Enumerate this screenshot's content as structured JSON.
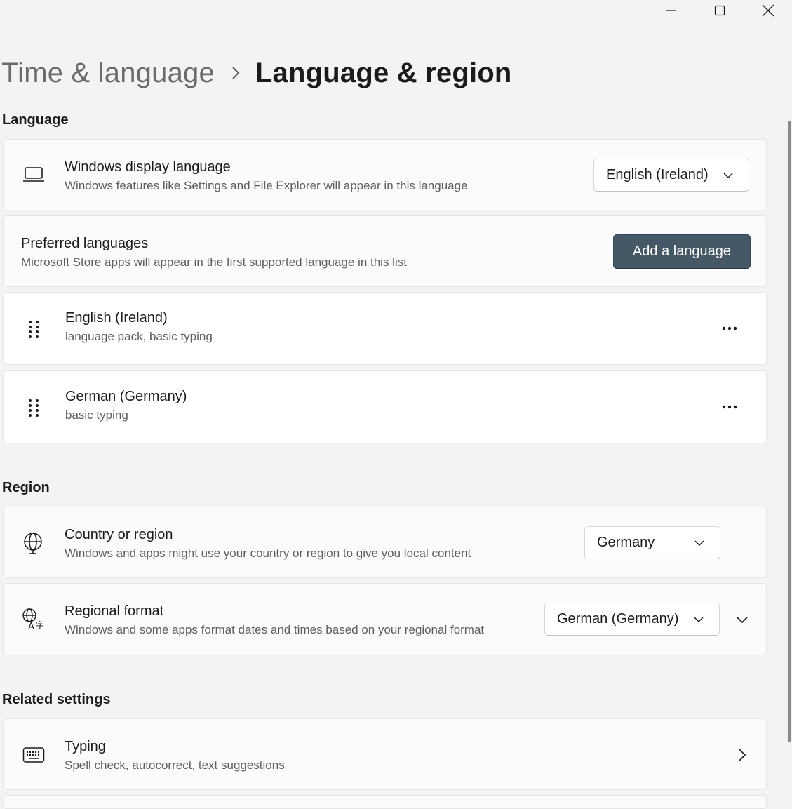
{
  "window_controls": {
    "minimize_icon": "minimize-icon",
    "maximize_icon": "maximize-icon",
    "close_icon": "close-icon"
  },
  "breadcrumb": {
    "parent": "Time & language",
    "separator_icon": "chevron-right-icon",
    "current": "Language & region"
  },
  "sections": {
    "language": "Language",
    "region": "Region",
    "related": "Related settings"
  },
  "display_language": {
    "icon": "laptop-icon",
    "title": "Windows display language",
    "subtitle": "Windows features like Settings and File Explorer will appear in this language",
    "selected": "English (Ireland)"
  },
  "preferred_languages": {
    "title": "Preferred languages",
    "subtitle": "Microsoft Store apps will appear in the first supported language in this list",
    "add_button": "Add a language",
    "items": [
      {
        "name": "English (Ireland)",
        "features": "language pack, basic typing",
        "drag_icon": "drag-handle-icon",
        "more_icon": "more-options-icon"
      },
      {
        "name": "German (Germany)",
        "features": "basic typing",
        "drag_icon": "drag-handle-icon",
        "more_icon": "more-options-icon"
      }
    ]
  },
  "country": {
    "icon": "globe-icon",
    "title": "Country or region",
    "subtitle": "Windows and apps might use your country or region to give you local content",
    "selected": "Germany"
  },
  "regional_format": {
    "icon": "globe-language-icon",
    "title": "Regional format",
    "subtitle": "Windows and some apps format dates and times based on your regional format",
    "selected": "German (Germany)",
    "expand_icon": "chevron-down-icon"
  },
  "typing": {
    "icon": "keyboard-icon",
    "title": "Typing",
    "subtitle": "Spell check, autocorrect, text suggestions",
    "nav_icon": "chevron-right-icon"
  },
  "colors": {
    "background": "#f3f3f3",
    "card": "#fbfbfb",
    "accent_button": "#455866"
  }
}
